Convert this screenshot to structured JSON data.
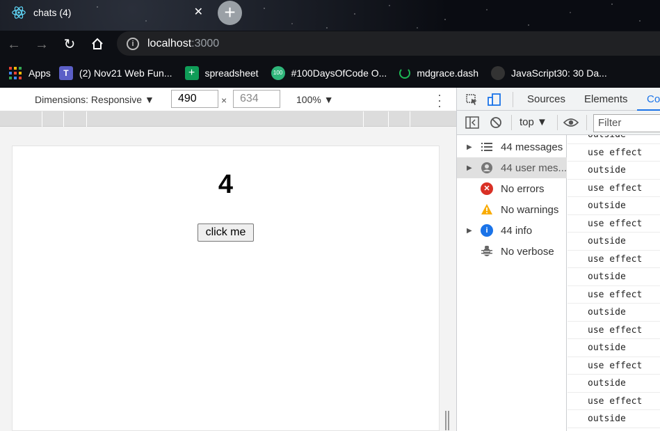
{
  "browser": {
    "tab_title": "chats (4)",
    "url_host": "localhost",
    "url_port": ":3000",
    "bookmarks": [
      {
        "label": "Apps",
        "icon": "apps-grid-icon"
      },
      {
        "label": "(2) Nov21 Web Fun...",
        "icon": "teams-icon"
      },
      {
        "label": "spreadsheet",
        "icon": "sheets-icon"
      },
      {
        "label": "#100DaysOfCode O...",
        "icon": "hundred-days-icon"
      },
      {
        "label": "mdgrace.dash",
        "icon": "loading-icon"
      },
      {
        "label": "JavaScript30: 30 Da...",
        "icon": "github-icon"
      }
    ]
  },
  "device_toolbar": {
    "dimensions_label": "Dimensions: Responsive ▼",
    "width_value": "490",
    "height_placeholder": "634",
    "times": "×",
    "zoom_label": "100% ▼"
  },
  "page": {
    "counter": "4",
    "button_label": "click me"
  },
  "devtools": {
    "tabs": [
      "Sources",
      "Elements",
      "Co"
    ],
    "context": "top ▼",
    "filter_placeholder": "Filter",
    "sidebar": [
      {
        "label": "44 messages",
        "icon": "list-icon",
        "expandable": true,
        "selected": false
      },
      {
        "label": "44 user mes...",
        "icon": "user-icon",
        "expandable": true,
        "selected": true
      },
      {
        "label": "No errors",
        "icon": "error-icon",
        "expandable": false,
        "selected": false
      },
      {
        "label": "No warnings",
        "icon": "warning-icon",
        "expandable": false,
        "selected": false
      },
      {
        "label": "44 info",
        "icon": "info-icon",
        "expandable": true,
        "selected": false
      },
      {
        "label": "No verbose",
        "icon": "bug-icon",
        "expandable": false,
        "selected": false
      }
    ],
    "logs": [
      "outside",
      "use effect",
      "outside",
      "use effect",
      "outside",
      "use effect",
      "outside",
      "use effect",
      "outside",
      "use effect",
      "outside",
      "use effect",
      "outside",
      "use effect",
      "outside",
      "use effect",
      "outside"
    ]
  }
}
